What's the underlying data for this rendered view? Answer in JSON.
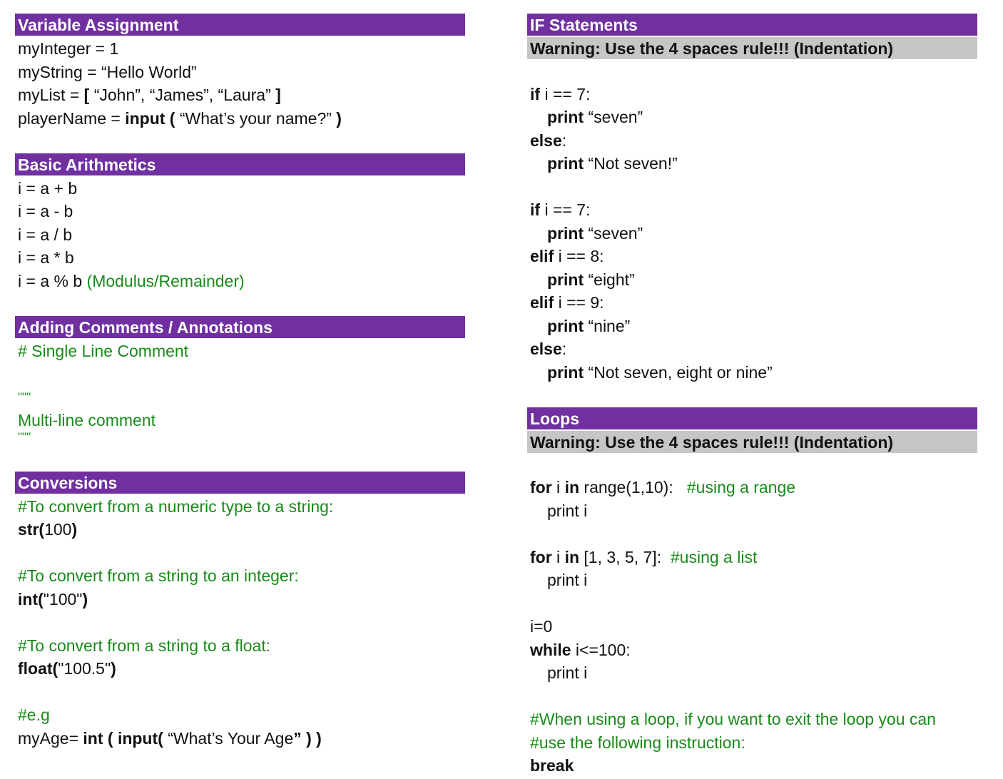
{
  "colors": {
    "header_bg": "#7030a0",
    "warning_bg": "#c6c6c6",
    "comment": "#1a8a1a"
  },
  "variable_assignment": {
    "title": "Variable Assignment",
    "l1": "myInteger = 1",
    "l2": "myString = “Hello World”",
    "l3_a": "myList = ",
    "l3_b": "[",
    "l3_c": " “John”, “James”, “Laura” ",
    "l3_d": "]",
    "l4_a": "playerName = ",
    "l4_b": "input (",
    "l4_c": " “What’s your name?” ",
    "l4_d": ")"
  },
  "basic_arithmetics": {
    "title": "Basic Arithmetics",
    "l1": "i = a + b",
    "l2": "i = a - b",
    "l3": "i = a / b",
    "l4": "i = a * b",
    "l5_a": "i = a % b ",
    "l5_b": "(Modulus/Remainder)"
  },
  "comments": {
    "title": "Adding Comments / Annotations",
    "single": "# Single Line Comment",
    "quote_open": "\"\"\"",
    "multi": "Multi-line comment",
    "quote_close": "\"\"\""
  },
  "conversions": {
    "title": "Conversions",
    "c1": "#To convert from a numeric type to a string:",
    "s_a": "str(",
    "s_b": "100",
    "s_c": ")",
    "c2": "#To convert from a string to an integer:",
    "i_a": "int(",
    "i_b": "\"100\"",
    "i_c": ")",
    "c3": "#To convert from a string to a float:",
    "f_a": "float(",
    "f_b": "\"100.5\"",
    "f_c": ")",
    "c4": "#e.g",
    "a_a": "myAge= ",
    "a_b": "int ( input(",
    "a_c": " “What’s Your Age",
    "a_d": "” ) )"
  },
  "if_statements": {
    "title": "IF Statements",
    "warning": "Warning: Use the 4 spaces rule!!! (Indentation)",
    "if": "if",
    "elif": "elif",
    "else": "else",
    "print": "print",
    "colon": ":",
    "cond7": " i == 7:",
    "cond8": " i == 8:",
    "cond9": " i == 9:",
    "seven": " “seven”",
    "not_seven": " “Not seven!”",
    "eight": " “eight”",
    "nine": " “nine”",
    "none": " “Not seven, eight or nine”"
  },
  "loops": {
    "title": "Loops",
    "warning": "Warning: Use the 4 spaces rule!!! (Indentation)",
    "for": "for",
    "in": "in",
    "i": " i ",
    "range_a": " range(1,10):   ",
    "range_comment": "#using a range",
    "print_i": "print i",
    "list_a": " [1, 3, 5, 7]:  ",
    "list_comment": "#using a list",
    "init": "i=0",
    "while": "while",
    "while_cond": " i<=100:",
    "exit1": "#When using a loop, if you want to exit the loop you can",
    "exit2": "#use the following instruction:",
    "break": "break"
  }
}
